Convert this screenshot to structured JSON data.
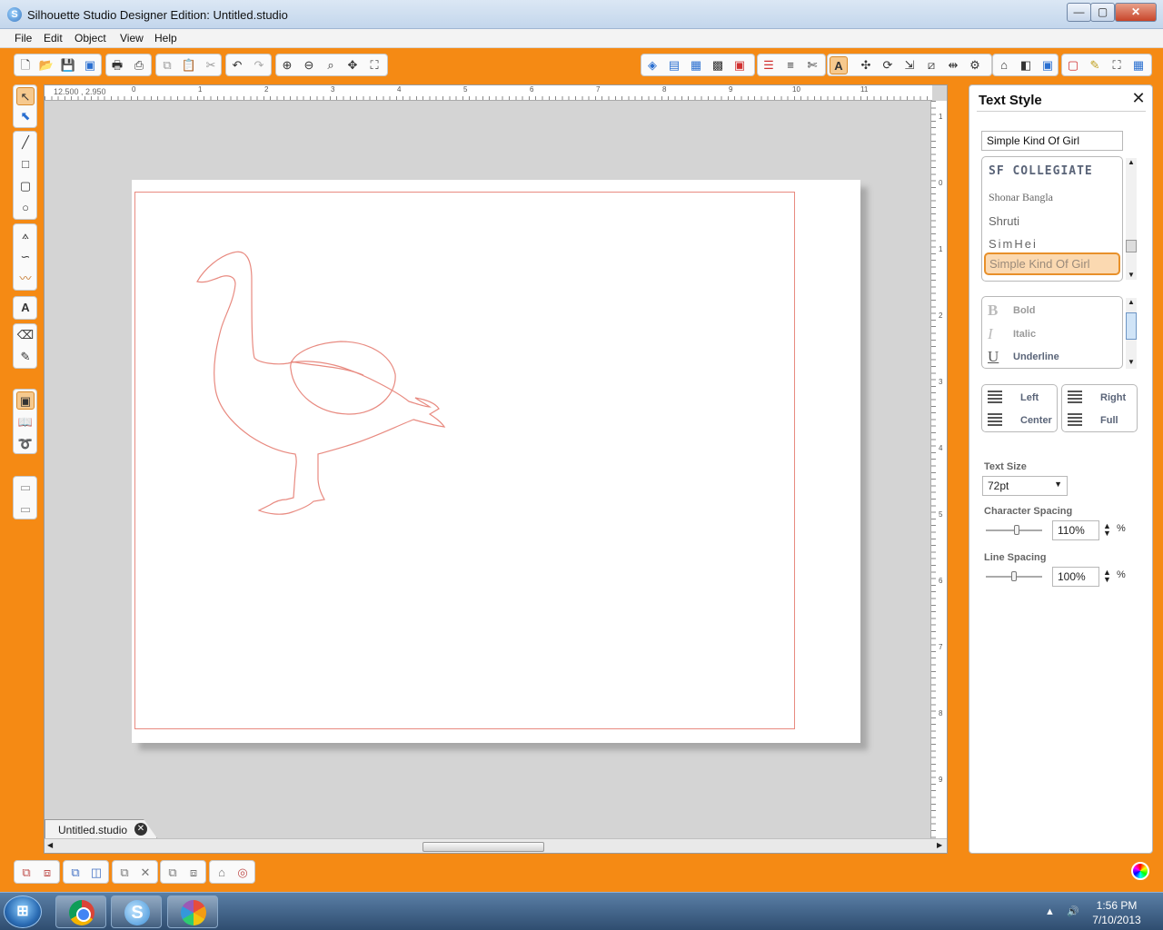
{
  "window": {
    "title": "Silhouette Studio Designer Edition: Untitled.studio",
    "app_icon": "S"
  },
  "menu": [
    "File",
    "Edit",
    "Object",
    "View",
    "Help"
  ],
  "toolbar": {
    "file_icons": [
      "new-file-icon",
      "open-folder-icon",
      "save-icon",
      "save-library-icon"
    ],
    "print_icons": [
      "print-icon",
      "send-to-cutter-icon"
    ],
    "clipboard_icons": [
      "copy-icon",
      "paste-icon",
      "cut-icon"
    ],
    "history_icons": [
      "undo-icon",
      "redo-icon"
    ],
    "zoom_icons": [
      "zoom-in-icon",
      "zoom-out-icon",
      "zoom-select-icon",
      "pan-icon",
      "fit-page-icon"
    ],
    "text_style_label": "A"
  },
  "canvas": {
    "coordinates": "12.500 , 2.950",
    "ruler_numbers": [
      "0",
      "1",
      "2",
      "3",
      "4",
      "5",
      "6",
      "7",
      "8",
      "9",
      "10",
      "11"
    ],
    "ruler_v_numbers": [
      "1",
      "0",
      "1",
      "2",
      "3",
      "4",
      "5",
      "6",
      "7",
      "8",
      "9"
    ]
  },
  "document_tab": {
    "label": "Untitled.studio",
    "close": "✕"
  },
  "text_style_panel": {
    "title": "Text Style",
    "close": "✕",
    "font_search_value": "Simple Kind Of Girl",
    "fonts": [
      "SF COLLEGIATE",
      "Shonar Bangla",
      "Shruti",
      "SimHei",
      "Simple Kind Of Girl"
    ],
    "selected_font": "Simple Kind Of Girl",
    "styles": [
      {
        "icon": "B",
        "label": "Bold",
        "enabled": false
      },
      {
        "icon": "I",
        "label": "Italic",
        "enabled": false
      },
      {
        "icon": "U",
        "label": "Underline",
        "enabled": true
      }
    ],
    "align": {
      "left": "Left",
      "center": "Center",
      "right": "Right",
      "full": "Full"
    },
    "text_size_label": "Text Size",
    "text_size_value": "72pt",
    "character_spacing_label": "Character Spacing",
    "character_spacing_value": "110%",
    "character_spacing_level": 0.55,
    "line_spacing_label": "Line Spacing",
    "line_spacing_value": "100%",
    "line_spacing_level": 0.5,
    "percent_unit": "%"
  },
  "taskbar": {
    "start_label": "⊞",
    "silhouette_label": "S",
    "time": "1:56 PM",
    "date": "7/10/2013"
  },
  "colors": {
    "accent_orange": "#f58a14",
    "cut_line": "#e88a80",
    "selection_orange": "#e8902a"
  }
}
